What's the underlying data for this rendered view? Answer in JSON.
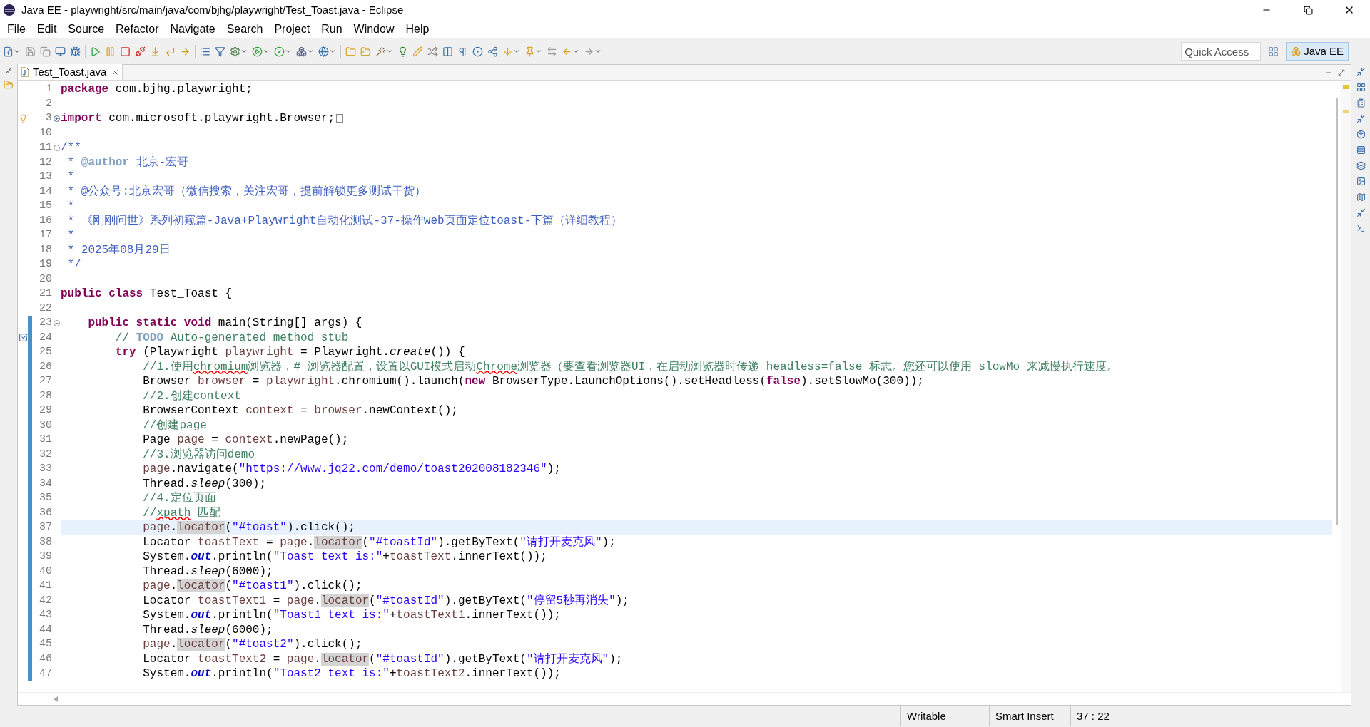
{
  "window": {
    "title": "Java EE - playwright/src/main/java/com/bjhg/playwright/Test_Toast.java - Eclipse"
  },
  "menu": [
    "File",
    "Edit",
    "Source",
    "Refactor",
    "Navigate",
    "Search",
    "Project",
    "Run",
    "Window",
    "Help"
  ],
  "quick_access": {
    "placeholder": "Quick Access"
  },
  "perspectives": [
    {
      "label": "Java EE",
      "selected": true
    }
  ],
  "editor": {
    "tabs": [
      {
        "label": "Test_Toast.java",
        "selected": true
      }
    ],
    "lines": [
      {
        "n": "1",
        "current": false,
        "range": false,
        "tokens": [
          {
            "kind": "kw",
            "text": "package"
          },
          {
            "kind": "plain",
            "text": " com.bjhg.playwright;"
          }
        ]
      },
      {
        "n": "2",
        "current": false,
        "range": false
      },
      {
        "n": "3",
        "current": false,
        "range": false,
        "fold": {
          "kind": "collapsed"
        },
        "marker": {
          "kind": "warning"
        },
        "tokens": [
          {
            "kind": "kw",
            "text": "import"
          },
          {
            "kind": "plain",
            "text": " com.microsoft.playwright.Browser;"
          }
        ]
      },
      {
        "n": "10",
        "current": false,
        "range": false
      },
      {
        "n": "11",
        "current": false,
        "range": false,
        "fold": {
          "kind": "expanded"
        },
        "tokens": [
          {
            "kind": "doc",
            "text": "/**"
          }
        ]
      },
      {
        "n": "12",
        "current": false,
        "range": false,
        "tokens": [
          {
            "kind": "doc",
            "text": " * "
          },
          {
            "kind": "doctag",
            "text": "@author"
          },
          {
            "kind": "doc",
            "text": " 北京-宏哥"
          }
        ]
      },
      {
        "n": "13",
        "current": false,
        "range": false,
        "tokens": [
          {
            "kind": "doc",
            "text": " *"
          }
        ]
      },
      {
        "n": "14",
        "current": false,
        "range": false,
        "tokens": [
          {
            "kind": "doc",
            "text": " * @公众号:北京宏哥（微信搜索，关注宏哥，提前解锁更多测试干货）"
          }
        ]
      },
      {
        "n": "15",
        "current": false,
        "range": false,
        "tokens": [
          {
            "kind": "doc",
            "text": " *"
          }
        ]
      },
      {
        "n": "16",
        "current": false,
        "range": false,
        "tokens": [
          {
            "kind": "doc",
            "text": " * 《刚刚问世》系列初窥篇-Java+Playwright自动化测试-37-操作web页面定位toast-下篇（详细教程）"
          }
        ]
      },
      {
        "n": "17",
        "current": false,
        "range": false,
        "tokens": [
          {
            "kind": "doc",
            "text": " *"
          }
        ]
      },
      {
        "n": "18",
        "current": false,
        "range": false,
        "tokens": [
          {
            "kind": "doc",
            "text": " * 2025年08月29日"
          }
        ]
      },
      {
        "n": "19",
        "current": false,
        "range": false,
        "tokens": [
          {
            "kind": "doc",
            "text": " */"
          }
        ]
      },
      {
        "n": "20",
        "current": false,
        "range": false
      },
      {
        "n": "21",
        "current": false,
        "range": false,
        "tokens": [
          {
            "kind": "kw",
            "text": "public class"
          },
          {
            "kind": "plain",
            "text": " Test_Toast {"
          }
        ]
      },
      {
        "n": "22",
        "current": false,
        "range": false
      },
      {
        "n": "23",
        "current": false,
        "range": true,
        "fold": {
          "kind": "expanded"
        },
        "tokens": [
          {
            "kind": "kw",
            "text": "    public static void"
          },
          {
            "kind": "plain",
            "text": " main(String[] args) {"
          }
        ]
      },
      {
        "n": "24",
        "current": false,
        "range": true,
        "marker": {
          "kind": "task"
        },
        "tokens": [
          {
            "kind": "comment",
            "text": "        // "
          },
          {
            "kind": "todo",
            "text": "TODO"
          },
          {
            "kind": "comment",
            "text": " Auto-generated method stub"
          }
        ]
      },
      {
        "n": "25",
        "current": false,
        "range": true,
        "tokens": [
          {
            "kind": "kw",
            "text": "        try"
          },
          {
            "kind": "plain",
            "text": " (Playwright "
          },
          {
            "kind": "var",
            "text": "playwright"
          },
          {
            "kind": "plain",
            "text": " = Playwright."
          },
          {
            "kind": "static",
            "text": "create"
          },
          {
            "kind": "plain",
            "text": "()) {"
          }
        ]
      },
      {
        "n": "26",
        "current": false,
        "range": true,
        "tokens": [
          {
            "kind": "comment",
            "text": "            //1.使用"
          },
          {
            "kind": "spell",
            "text": "chromium"
          },
          {
            "kind": "comment",
            "text": "浏览器，# 浏览器配置，设置以GUI模式启动"
          },
          {
            "kind": "spell",
            "text": "Chrome"
          },
          {
            "kind": "comment",
            "text": "浏览器（要查看浏览器UI，在启动浏览器时传递 headless=false 标志。您还可以使用 slowMo 来减慢执行速度。"
          }
        ]
      },
      {
        "n": "27",
        "current": false,
        "range": true,
        "tokens": [
          {
            "kind": "plain",
            "text": "            Browser "
          },
          {
            "kind": "var",
            "text": "browser"
          },
          {
            "kind": "plain",
            "text": " = "
          },
          {
            "kind": "var",
            "text": "playwright"
          },
          {
            "kind": "plain",
            "text": ".chromium().launch("
          },
          {
            "kind": "kw",
            "text": "new"
          },
          {
            "kind": "plain",
            "text": " BrowserType.LaunchOptions().setHeadless("
          },
          {
            "kind": "kw",
            "text": "false"
          },
          {
            "kind": "plain",
            "text": ").setSlowMo(300));"
          }
        ]
      },
      {
        "n": "28",
        "current": false,
        "range": true,
        "tokens": [
          {
            "kind": "comment",
            "text": "            //2.创建context"
          }
        ]
      },
      {
        "n": "29",
        "current": false,
        "range": true,
        "tokens": [
          {
            "kind": "plain",
            "text": "            BrowserContext "
          },
          {
            "kind": "var",
            "text": "context"
          },
          {
            "kind": "plain",
            "text": " = "
          },
          {
            "kind": "var",
            "text": "browser"
          },
          {
            "kind": "plain",
            "text": ".newContext();"
          }
        ]
      },
      {
        "n": "30",
        "current": false,
        "range": true,
        "tokens": [
          {
            "kind": "comment",
            "text": "            //创建page"
          }
        ]
      },
      {
        "n": "31",
        "current": false,
        "range": true,
        "tokens": [
          {
            "kind": "plain",
            "text": "            Page "
          },
          {
            "kind": "var",
            "text": "page"
          },
          {
            "kind": "plain",
            "text": " = "
          },
          {
            "kind": "var",
            "text": "context"
          },
          {
            "kind": "plain",
            "text": ".newPage();"
          }
        ]
      },
      {
        "n": "32",
        "current": false,
        "range": true,
        "tokens": [
          {
            "kind": "comment",
            "text": "            //3.浏览器访问demo"
          }
        ]
      },
      {
        "n": "33",
        "current": false,
        "range": true,
        "tokens": [
          {
            "kind": "var",
            "text": "            page"
          },
          {
            "kind": "plain",
            "text": ".navigate("
          },
          {
            "kind": "string",
            "text": "\"https://www.jq22.com/demo/toast202008182346\""
          },
          {
            "kind": "plain",
            "text": ");"
          }
        ]
      },
      {
        "n": "34",
        "current": false,
        "range": true,
        "tokens": [
          {
            "kind": "plain",
            "text": "            Thread."
          },
          {
            "kind": "static",
            "text": "sleep"
          },
          {
            "kind": "plain",
            "text": "(300);"
          }
        ]
      },
      {
        "n": "35",
        "current": false,
        "range": true,
        "tokens": [
          {
            "kind": "comment",
            "text": "            //4.定位页面"
          }
        ]
      },
      {
        "n": "36",
        "current": false,
        "range": true,
        "tokens": [
          {
            "kind": "comment",
            "text": "            //"
          },
          {
            "kind": "spell",
            "text": "xpath"
          },
          {
            "kind": "comment",
            "text": " 匹配"
          }
        ]
      },
      {
        "n": "37",
        "current": true,
        "range": true,
        "tokens": [
          {
            "kind": "var",
            "text": "            page"
          },
          {
            "kind": "plain",
            "text": "."
          },
          {
            "kind": "occ",
            "text": "locator"
          },
          {
            "kind": "plain",
            "text": "("
          },
          {
            "kind": "string",
            "text": "\"#toast\""
          },
          {
            "kind": "plain",
            "text": ").click();"
          }
        ]
      },
      {
        "n": "38",
        "current": false,
        "range": true,
        "tokens": [
          {
            "kind": "plain",
            "text": "            Locator "
          },
          {
            "kind": "var",
            "text": "toastText"
          },
          {
            "kind": "plain",
            "text": " = "
          },
          {
            "kind": "var",
            "text": "page"
          },
          {
            "kind": "plain",
            "text": "."
          },
          {
            "kind": "occ",
            "text": "locator"
          },
          {
            "kind": "plain",
            "text": "("
          },
          {
            "kind": "string",
            "text": "\"#toastId\""
          },
          {
            "kind": "plain",
            "text": ").getByText("
          },
          {
            "kind": "string",
            "text": "\"请打开麦克风\""
          },
          {
            "kind": "plain",
            "text": ");"
          }
        ]
      },
      {
        "n": "39",
        "current": false,
        "range": true,
        "tokens": [
          {
            "kind": "plain",
            "text": "            System."
          },
          {
            "kind": "field",
            "text": "out"
          },
          {
            "kind": "plain",
            "text": ".println("
          },
          {
            "kind": "string",
            "text": "\"Toast text is:\""
          },
          {
            "kind": "plain",
            "text": "+"
          },
          {
            "kind": "var",
            "text": "toastText"
          },
          {
            "kind": "plain",
            "text": ".innerText());"
          }
        ]
      },
      {
        "n": "40",
        "current": false,
        "range": true,
        "tokens": [
          {
            "kind": "plain",
            "text": "            Thread."
          },
          {
            "kind": "static",
            "text": "sleep"
          },
          {
            "kind": "plain",
            "text": "(6000);"
          }
        ]
      },
      {
        "n": "41",
        "current": false,
        "range": true,
        "tokens": [
          {
            "kind": "var",
            "text": "            page"
          },
          {
            "kind": "plain",
            "text": "."
          },
          {
            "kind": "occ",
            "text": "locator"
          },
          {
            "kind": "plain",
            "text": "("
          },
          {
            "kind": "string",
            "text": "\"#toast1\""
          },
          {
            "kind": "plain",
            "text": ").click();"
          }
        ]
      },
      {
        "n": "42",
        "current": false,
        "range": true,
        "tokens": [
          {
            "kind": "plain",
            "text": "            Locator "
          },
          {
            "kind": "var",
            "text": "toastText1"
          },
          {
            "kind": "plain",
            "text": " = "
          },
          {
            "kind": "var",
            "text": "page"
          },
          {
            "kind": "plain",
            "text": "."
          },
          {
            "kind": "occ",
            "text": "locator"
          },
          {
            "kind": "plain",
            "text": "("
          },
          {
            "kind": "string",
            "text": "\"#toastId\""
          },
          {
            "kind": "plain",
            "text": ").getByText("
          },
          {
            "kind": "string",
            "text": "\"停留5秒再消失\""
          },
          {
            "kind": "plain",
            "text": ");"
          }
        ]
      },
      {
        "n": "43",
        "current": false,
        "range": true,
        "tokens": [
          {
            "kind": "plain",
            "text": "            System."
          },
          {
            "kind": "field",
            "text": "out"
          },
          {
            "kind": "plain",
            "text": ".println("
          },
          {
            "kind": "string",
            "text": "\"Toast1 text is:\""
          },
          {
            "kind": "plain",
            "text": "+"
          },
          {
            "kind": "var",
            "text": "toastText1"
          },
          {
            "kind": "plain",
            "text": ".innerText());"
          }
        ]
      },
      {
        "n": "44",
        "current": false,
        "range": true,
        "tokens": [
          {
            "kind": "plain",
            "text": "            Thread."
          },
          {
            "kind": "static",
            "text": "sleep"
          },
          {
            "kind": "plain",
            "text": "(6000);"
          }
        ]
      },
      {
        "n": "45",
        "current": false,
        "range": true,
        "tokens": [
          {
            "kind": "var",
            "text": "            page"
          },
          {
            "kind": "plain",
            "text": "."
          },
          {
            "kind": "occ",
            "text": "locator"
          },
          {
            "kind": "plain",
            "text": "("
          },
          {
            "kind": "string",
            "text": "\"#toast2\""
          },
          {
            "kind": "plain",
            "text": ").click();"
          }
        ]
      },
      {
        "n": "46",
        "current": false,
        "range": true,
        "tokens": [
          {
            "kind": "plain",
            "text": "            Locator "
          },
          {
            "kind": "var",
            "text": "toastText2"
          },
          {
            "kind": "plain",
            "text": " = "
          },
          {
            "kind": "var",
            "text": "page"
          },
          {
            "kind": "plain",
            "text": "."
          },
          {
            "kind": "occ",
            "text": "locator"
          },
          {
            "kind": "plain",
            "text": "("
          },
          {
            "kind": "string",
            "text": "\"#toastId\""
          },
          {
            "kind": "plain",
            "text": ").getByText("
          },
          {
            "kind": "string",
            "text": "\"请打开麦克风\""
          },
          {
            "kind": "plain",
            "text": ");"
          }
        ]
      },
      {
        "n": "47",
        "current": false,
        "range": true,
        "tokens": [
          {
            "kind": "plain",
            "text": "            System."
          },
          {
            "kind": "field",
            "text": "out"
          },
          {
            "kind": "plain",
            "text": ".println("
          },
          {
            "kind": "string",
            "text": "\"Toast2 text is:\""
          },
          {
            "kind": "plain",
            "text": "+"
          },
          {
            "kind": "var",
            "text": "toastText2"
          },
          {
            "kind": "plain",
            "text": ".innerText());"
          }
        ]
      }
    ]
  },
  "status_bar": {
    "mode": "Writable",
    "insert": "Smart Insert",
    "position": "37 : 22"
  }
}
